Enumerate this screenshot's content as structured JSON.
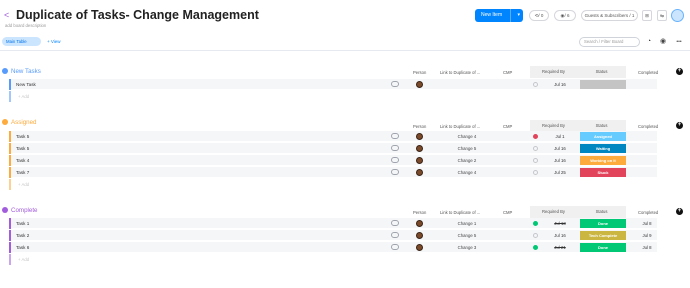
{
  "board": {
    "title": "Duplicate of Tasks- Change Management",
    "description": "add board description",
    "new_item": "New Item",
    "activity_count": "/ 0",
    "views_count": "/ 6",
    "guests": "Guests & Subscribers / 1",
    "main_table": "Main Table",
    "add_view": "+ View",
    "search_placeholder": "Search / Filter Board"
  },
  "columns": {
    "person": "Person",
    "link": "Link to Duplicate of ...",
    "cmp": "CMP",
    "required": "Required By",
    "status": "Status",
    "completed": "Completed"
  },
  "groups": [
    {
      "name": "New Tasks",
      "color": "#579bfc",
      "add_label": "+ Add",
      "rows": [
        {
          "name": "New Task",
          "link": "",
          "req_icon": "empty",
          "req": "Jul 16",
          "req_strike": false,
          "status": "",
          "status_color": "#c4c4c4",
          "completed": ""
        }
      ]
    },
    {
      "name": "Assigned",
      "color": "#fdab3d",
      "add_label": "+ Add",
      "rows": [
        {
          "name": "Task 5",
          "link": "Change 4",
          "req_icon": "alert",
          "req": "Jul 1",
          "req_strike": false,
          "status": "Assigned",
          "status_color": "#66ccff",
          "completed": ""
        },
        {
          "name": "Task 5",
          "link": "Change 5",
          "req_icon": "empty",
          "req": "Jul 16",
          "req_strike": false,
          "status": "Waiting",
          "status_color": "#0086c0",
          "completed": ""
        },
        {
          "name": "Task 4",
          "link": "Change 2",
          "req_icon": "empty",
          "req": "Jul 16",
          "req_strike": false,
          "status": "Working on it",
          "status_color": "#fdab3d",
          "completed": ""
        },
        {
          "name": "Task 7",
          "link": "Change 4",
          "req_icon": "empty",
          "req": "Jul 25",
          "req_strike": false,
          "status": "Stuck",
          "status_color": "#e2445c",
          "completed": ""
        }
      ]
    },
    {
      "name": "Complete",
      "color": "#a25ddc",
      "add_label": "+ Add",
      "rows": [
        {
          "name": "Task 1",
          "link": "Change 1",
          "req_icon": "done",
          "req": "Jul 13",
          "req_strike": true,
          "status": "Done",
          "status_color": "#00c875",
          "completed": "Jul 8"
        },
        {
          "name": "Task 2",
          "link": "Change 5",
          "req_icon": "empty",
          "req": "Jul 16",
          "req_strike": false,
          "status": "Tech Complete",
          "status_color": "#cab641",
          "completed": "Jul 9"
        },
        {
          "name": "Task 6",
          "link": "Change 3",
          "req_icon": "done",
          "req": "Jul 21",
          "req_strike": true,
          "status": "Done",
          "status_color": "#00c875",
          "completed": "Jul 8"
        }
      ]
    }
  ]
}
